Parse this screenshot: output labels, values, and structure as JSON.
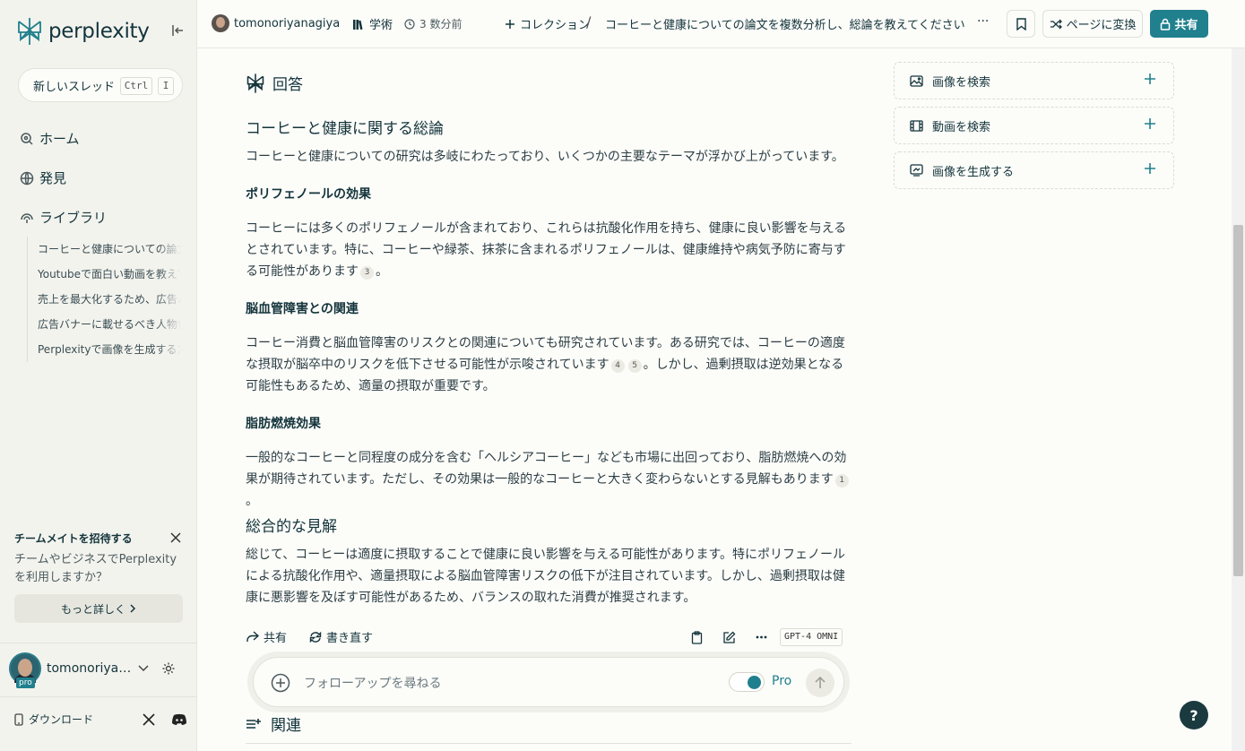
{
  "brand": {
    "logo_text": "perplexity",
    "accent": "#20808d"
  },
  "sidebar": {
    "new_thread_label": "新しいスレッド",
    "shortcut_key1": "Ctrl",
    "shortcut_key2": "I",
    "nav": [
      {
        "label": "ホーム",
        "icon": "search-icon"
      },
      {
        "label": "発見",
        "icon": "globe-icon"
      },
      {
        "label": "ライブラリ",
        "icon": "library-icon"
      }
    ],
    "library_items": [
      "コーヒーと健康についての論文を複数分析し、総論を教えてください",
      "Youtubeで面白い動画を教えてください",
      "売上を最大化するため、広告バナーを",
      "広告バナーに載せるべき人物像",
      "Perplexityで画像を生成する方法"
    ],
    "invite": {
      "title": "チームメイトを招待する",
      "desc": "チームやビジネスでPerplexityを利用しますか？",
      "button": "もっと詳しく"
    },
    "user_name": "tomonoriyanagiya",
    "pro_badge": "pro",
    "download_label": "ダウンロード"
  },
  "topbar": {
    "author": "tomonoriyanagiya",
    "focus": "学術",
    "time": "3 数分前",
    "collection": "コレクション",
    "separator": "/",
    "thread_title": "コーヒーと健康についての論文を複数分析し、総論を教えてください",
    "more": "···",
    "convert_label": "ページに変換",
    "share_label": "共有"
  },
  "answer": {
    "header": "回答",
    "title": "コーヒーと健康に関する総論",
    "intro": "コーヒーと健康についての研究は多岐にわたっており、いくつかの主要なテーマが浮かび上がっています。",
    "sections": [
      {
        "heading": "ポリフェノールの効果",
        "text": "コーヒーには多くのポリフェノールが含まれており、これらは抗酸化作用を持ち、健康に良い影響を与えるとされています。特に、コーヒーや緑茶、抹茶に含まれるポリフェノールは、健康維持や病気予防に寄与する可能性があります",
        "cites": [
          "3"
        ],
        "tail": "。"
      },
      {
        "heading": "脳血管障害との関連",
        "text": "コーヒー消費と脳血管障害のリスクとの関連についても研究されています。ある研究では、コーヒーの適度な摂取が脳卒中のリスクを低下させる可能性が示唆されています",
        "cites": [
          "4",
          "5"
        ],
        "tail": "。しかし、過剰摂取は逆効果となる可能性もあるため、適量の摂取が重要です。"
      },
      {
        "heading": "脂肪燃焼効果",
        "text": "一般的なコーヒーと同程度の成分を含む「ヘルシアコーヒー」なども市場に出回っており、脂肪燃焼への効果が期待されています。ただし、その効果は一般的なコーヒーと大きく変わらないとする見解もあります",
        "cites": [
          "1"
        ],
        "tail": "。"
      }
    ],
    "summary_title": "総合的な見解",
    "summary": "総じて、コーヒーは適度に摂取することで健康に良い影響を与える可能性があります。特にポリフェノールによる抗酸化作用や、適量摂取による脳血管障害リスクの低下が注目されています。しかし、過剰摂取は健康に悪影響を及ぼす可能性があるため、バランスの取れた消費が推奨されます。",
    "actions": {
      "share": "共有",
      "rewrite": "書き直す",
      "model": "GPT-4 OMNI"
    }
  },
  "followup": {
    "placeholder": "フォローアップを尋ねる",
    "pro_label": "Pro",
    "pro_enabled": true
  },
  "related": {
    "label": "関連"
  },
  "right_panel": [
    {
      "label": "画像を検索",
      "icon": "image-icon"
    },
    {
      "label": "動画を検索",
      "icon": "video-icon"
    },
    {
      "label": "画像を生成する",
      "icon": "generate-image-icon"
    }
  ],
  "help_label": "?"
}
